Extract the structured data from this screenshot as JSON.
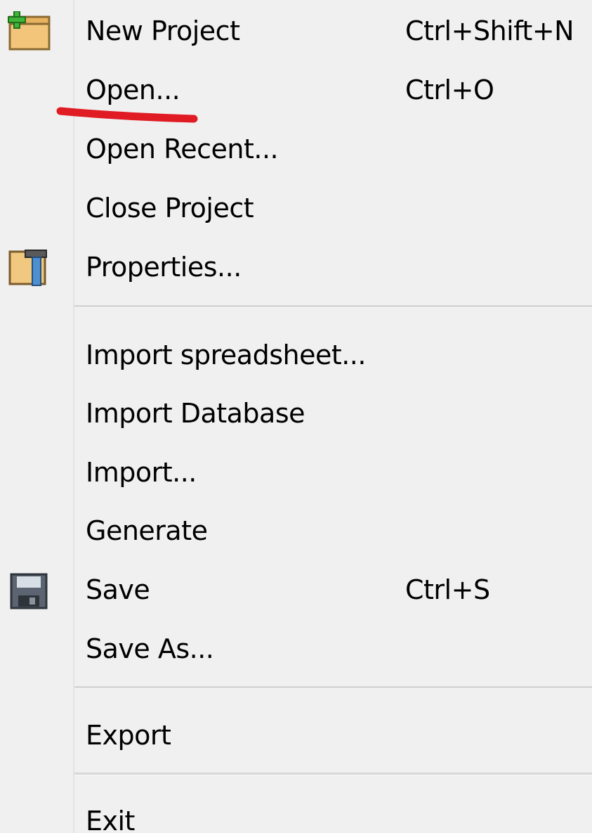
{
  "menu": {
    "items": {
      "new_project": {
        "label": "New Project",
        "shortcut": "Ctrl+Shift+N",
        "icon": "new-project-icon"
      },
      "open": {
        "label": "Open...",
        "shortcut": "Ctrl+O"
      },
      "open_recent": {
        "label": "Open Recent..."
      },
      "close_project": {
        "label": "Close Project"
      },
      "properties": {
        "label": "Properties...",
        "icon": "properties-icon"
      },
      "import_spreadsheet": {
        "label": "Import spreadsheet..."
      },
      "import_database": {
        "label": "Import Database"
      },
      "import": {
        "label": "Import..."
      },
      "generate": {
        "label": "Generate"
      },
      "save": {
        "label": "Save",
        "shortcut": "Ctrl+S",
        "icon": "floppy-disk-icon"
      },
      "save_as": {
        "label": "Save As..."
      },
      "export": {
        "label": "Export"
      },
      "exit": {
        "label": "Exit"
      }
    }
  },
  "colors": {
    "background": "#f0f0f0",
    "separator": "#d7d7d7",
    "annotation": "#e01b24"
  }
}
